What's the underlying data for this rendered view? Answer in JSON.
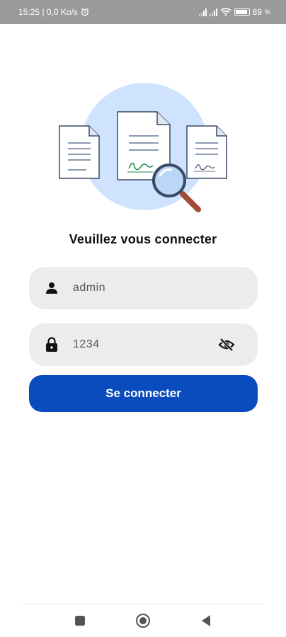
{
  "status_bar": {
    "time_speed": "15:25 | 0,0 Ko/s",
    "battery": "89"
  },
  "login": {
    "title": "Veuillez vous connecter",
    "username_value": "admin",
    "password_value": "1234",
    "submit_label": "Se connecter"
  },
  "icons": {
    "user": "person-icon",
    "lock": "lock-icon",
    "visibility": "eye-off-icon",
    "alarm": "alarm-icon",
    "wifi": "wifi-icon",
    "battery": "battery-icon",
    "recents": "square-recents-icon",
    "home": "circle-home-icon",
    "back": "triangle-back-icon"
  },
  "colors": {
    "primary": "#0a4bbd",
    "field_bg": "#ececec",
    "illustration_circle": "#cfe3ff",
    "status_bar": "#9a9a9a"
  }
}
